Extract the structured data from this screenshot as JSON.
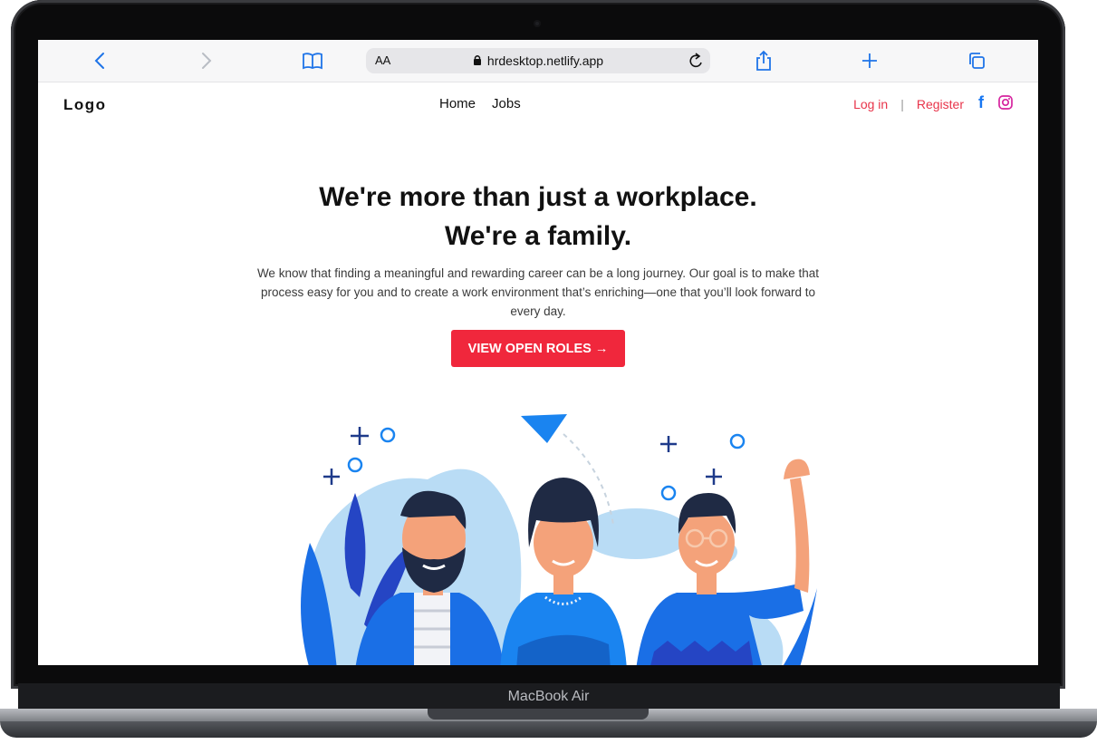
{
  "device": {
    "label": "MacBook Air"
  },
  "browser": {
    "aa_label": "AA",
    "url": "hrdesktop.netlify.app",
    "icons": [
      "back-icon",
      "forward-icon",
      "bookmarks-icon",
      "lock-icon",
      "reload-icon",
      "share-icon",
      "new-tab-icon",
      "tabs-icon"
    ],
    "accent": "#1f74e8"
  },
  "site": {
    "logo": "Logo",
    "nav": {
      "home": "Home",
      "jobs": "Jobs"
    },
    "auth": {
      "login": "Log in",
      "separator": "|",
      "register": "Register"
    },
    "social": [
      "facebook-icon",
      "instagram-icon"
    ],
    "brand_color": "#f0273c"
  },
  "hero": {
    "headline_line1": "We're more than just a workplace.",
    "headline_line2": "We're a family.",
    "lead": "We know that finding a meaningful and rewarding career can be a long journey. Our goal is to make that process easy for you and to create a work environment that’s enriching—one that you’ll look forward to every day.",
    "cta_label": "VIEW OPEN ROLES →"
  }
}
